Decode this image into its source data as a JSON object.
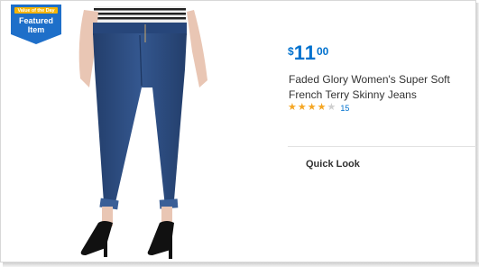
{
  "badge": {
    "small_text": "Value of the Day",
    "line1": "Featured",
    "line2": "Item"
  },
  "product": {
    "price_currency": "$",
    "price_whole": "11",
    "price_cents": "00",
    "title": "Faded Glory Women's Super Soft French Terry Skinny Jeans",
    "rating": 4,
    "rating_max": 5,
    "review_count": "15",
    "image_icon": "jeans-product-photo-icon"
  },
  "actions": {
    "quick_look": "Quick Look"
  },
  "colors": {
    "accent": "#0071ce",
    "star": "#f5a623",
    "badge_fill": "#1e6fc9",
    "badge_top": "#f5b400",
    "denim": "#2c4b7e"
  }
}
